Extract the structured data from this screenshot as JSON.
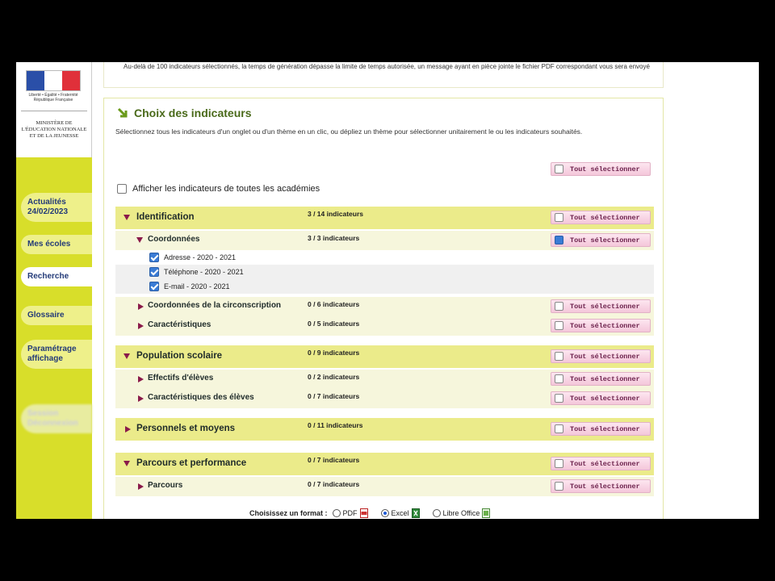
{
  "sidebar": {
    "logo_motto": "Liberté • Égalité • Fraternité  République Française",
    "ministry": "MINISTÈRE DE L'ÉDUCATION NATIONALE ET DE LA JEUNESSE",
    "items": [
      {
        "label": "Actualités 24/02/2023"
      },
      {
        "label": "Mes écoles"
      },
      {
        "label": "Recherche"
      },
      {
        "label": "Glossaire"
      },
      {
        "label": "Paramétrage affichage"
      },
      {
        "label": "Session Déconnexion"
      }
    ]
  },
  "top_note": "Au-delà de 100 indicateurs sélectionnés, la temps de génération dépasse la limite de temps autorisée, un message ayant en pièce jointe le fichier PDF correspondant vous sera envoyé",
  "panel": {
    "title": "Choix des indicateurs",
    "description": "Sélectionnez tous les indicateurs d'un onglet ou d'un thème en un clic, ou dépliez un thème pour sélectionner unitairement le ou les indicateurs souhaités.",
    "select_all_label": "Tout sélectionner",
    "all_academies_label": "Afficher les indicateurs de toutes les académies"
  },
  "rows": {
    "identification": {
      "name": "Identification",
      "count": "3 / 14 indicateurs"
    },
    "coordonnees": {
      "name": "Coordonnées",
      "count": "3 / 3 indicateurs"
    },
    "coordonnees_items": [
      {
        "label": "Adresse - 2020 - 2021"
      },
      {
        "label": "Téléphone - 2020 - 2021"
      },
      {
        "label": "E-mail - 2020 - 2021"
      }
    ],
    "coord_circ": {
      "name": "Coordonnées de la circonscription",
      "count": "0 / 6 indicateurs"
    },
    "caracteristiques": {
      "name": "Caractéristiques",
      "count": "0 / 5 indicateurs"
    },
    "population": {
      "name": "Population scolaire",
      "count": "0 / 9 indicateurs"
    },
    "effectifs": {
      "name": "Effectifs d'élèves",
      "count": "0 / 2 indicateurs"
    },
    "carac_eleves": {
      "name": "Caractéristiques des élèves",
      "count": "0 / 7 indicateurs"
    },
    "personnels": {
      "name": "Personnels et moyens",
      "count": "0 / 11 indicateurs"
    },
    "parcours_perf": {
      "name": "Parcours et performance",
      "count": "0 / 7 indicateurs"
    },
    "parcours": {
      "name": "Parcours",
      "count": "0 / 7 indicateurs"
    }
  },
  "format": {
    "label": "Choisissez un format :",
    "options": [
      {
        "label": "PDF",
        "selected": false
      },
      {
        "label": "Excel",
        "selected": true
      },
      {
        "label": "Libre Office",
        "selected": false
      }
    ]
  },
  "colors": {
    "sidebar": "#d8de2a",
    "theme_row": "#ebeb8a",
    "select_button": "#f4c7da",
    "title_green": "#4a6a1a"
  }
}
